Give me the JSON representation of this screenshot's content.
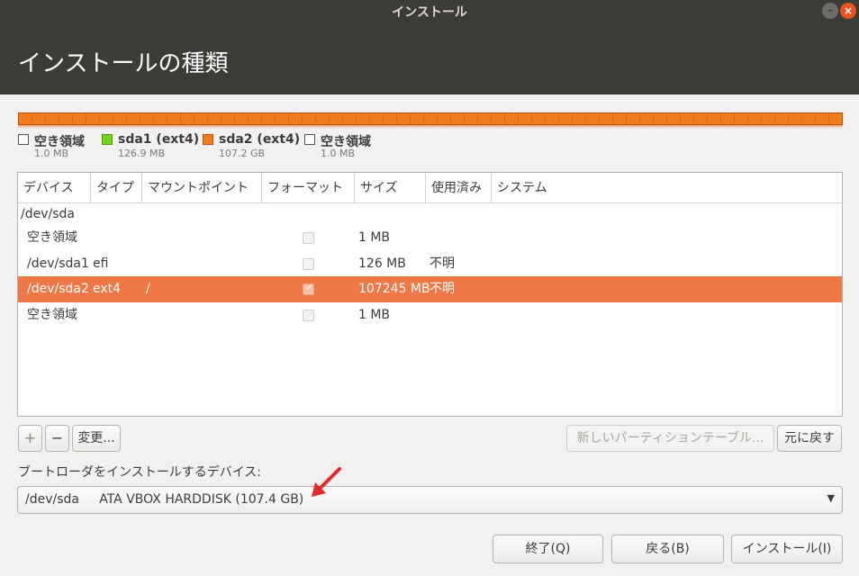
{
  "window": {
    "title": "インストール",
    "min_glyph": "–",
    "close_glyph": "×"
  },
  "header": {
    "title": "インストールの種類"
  },
  "legend": [
    {
      "name": "空き領域",
      "size": "1.0 MB",
      "swatch": "free"
    },
    {
      "name": "sda1 (ext4)",
      "size": "126.9 MB",
      "swatch": "green"
    },
    {
      "name": "sda2 (ext4)",
      "size": "107.2 GB",
      "swatch": "orange"
    },
    {
      "name": "空き領域",
      "size": "1.0 MB",
      "swatch": "free"
    }
  ],
  "table": {
    "columns": [
      "デバイス",
      "タイプ",
      "マウントポイント",
      "フォーマット",
      "サイズ",
      "使用済み",
      "システム"
    ],
    "rows": [
      {
        "device": "/dev/sda",
        "type": "",
        "mount": "",
        "format": null,
        "size": "",
        "used": "",
        "system": "",
        "selected": false,
        "indent": false
      },
      {
        "device": "空き領域",
        "type": "",
        "mount": "",
        "format": false,
        "size": "1 MB",
        "used": "",
        "system": "",
        "selected": false,
        "indent": true
      },
      {
        "device": "/dev/sda1",
        "type": "efi",
        "mount": "",
        "format": false,
        "size": "126 MB",
        "used": "不明",
        "system": "",
        "selected": false,
        "indent": true
      },
      {
        "device": "/dev/sda2",
        "type": "ext4",
        "mount": "/",
        "format": true,
        "size": "107245 MB",
        "used": "不明",
        "system": "",
        "selected": true,
        "indent": true
      },
      {
        "device": "空き領域",
        "type": "",
        "mount": "",
        "format": false,
        "size": "1 MB",
        "used": "",
        "system": "",
        "selected": false,
        "indent": true
      }
    ]
  },
  "toolbar": {
    "add_label": "+",
    "remove_label": "−",
    "change_label": "変更...",
    "new_table_label": "新しいパーティションテーブル...",
    "revert_label": "元に戻す"
  },
  "bootloader": {
    "label": "ブートローダをインストールするデバイス:",
    "selected": "/dev/sda     ATA VBOX HARDDISK (107.4 GB)"
  },
  "footer": {
    "quit_label": "終了(Q)",
    "back_label": "戻る(B)",
    "install_label": "インストール(I)"
  },
  "colors": {
    "accent": "#f07746",
    "bar_orange": "#f07c1e",
    "green": "#73d216",
    "header_bg": "#3c3b37",
    "arrow_red": "#e32b2b"
  },
  "icons": {
    "dropdown": "triangle-down",
    "annotation": "red-arrow"
  }
}
